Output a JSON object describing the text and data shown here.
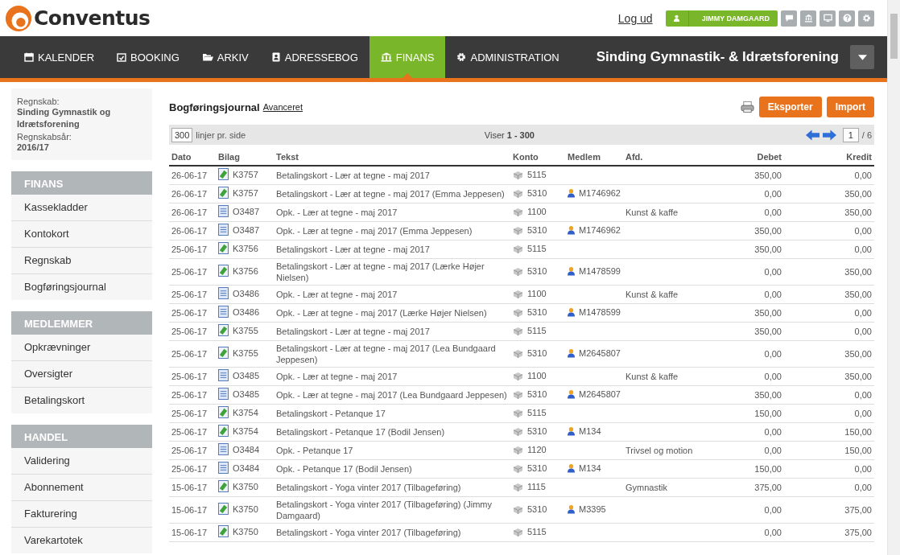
{
  "header": {
    "logo": "Conventus",
    "logout": "Log ud",
    "user": "JIMMY DAMGAARD"
  },
  "nav": {
    "items": [
      {
        "label": "KALENDER",
        "selected": false
      },
      {
        "label": "BOOKING",
        "selected": false
      },
      {
        "label": "ARKIV",
        "selected": false
      },
      {
        "label": "ADRESSEBOG",
        "selected": false
      },
      {
        "label": "FINANS",
        "selected": true
      },
      {
        "label": "ADMINISTRATION",
        "selected": false
      }
    ],
    "organization": "Sinding Gymnastik- & Idrætsforening"
  },
  "sidebar": {
    "info": [
      {
        "label": "Regnskab:",
        "value": "Sinding Gymnastik og Idrætsforening"
      },
      {
        "label": "Regnskabsår:",
        "value": "2016/17"
      }
    ],
    "sections": [
      {
        "title": "FINANS",
        "items": [
          {
            "label": "Kassekladder"
          },
          {
            "label": "Kontokort"
          },
          {
            "label": "Regnskab"
          },
          {
            "label": "Bogføringsjournal"
          }
        ]
      },
      {
        "title": "MEDLEMMER",
        "items": [
          {
            "label": "Opkrævninger"
          },
          {
            "label": "Oversigter"
          },
          {
            "label": "Betalingskort"
          }
        ]
      },
      {
        "title": "HANDEL",
        "items": [
          {
            "label": "Validering"
          },
          {
            "label": "Abonnement"
          },
          {
            "label": "Fakturering"
          },
          {
            "label": "Varekartotek"
          }
        ]
      }
    ]
  },
  "main": {
    "title": "Bogføringsjournal",
    "advanced_link": "Avanceret",
    "buttons": [
      "Eksporter",
      "Import"
    ],
    "pager": {
      "per_page": "300",
      "per_page_label": "linjer pr. side",
      "showing_prefix": "Viser",
      "showing_range": "1 - 300",
      "page": "1",
      "total": "/ 6"
    },
    "table": {
      "columns": [
        "Dato",
        "Bilag",
        "Tekst",
        "Konto",
        "Medlem",
        "Afd.",
        "Debet",
        "Kredit"
      ],
      "rows": [
        {
          "dato": "26-06-17",
          "kind": "card",
          "bilag": "K3757",
          "tekst": "Betalingskort - Lær at tegne - maj 2017",
          "konto": "5115",
          "debet": "350,00",
          "kredit": "0,00"
        },
        {
          "dato": "26-06-17",
          "kind": "card",
          "bilag": "K3757",
          "tekst": "Betalingskort - Lær at tegne - maj 2017 (Emma Jeppesen)",
          "konto": "5310",
          "medlem": "M1746962",
          "debet": "0,00",
          "kredit": "350,00"
        },
        {
          "dato": "26-06-17",
          "kind": "invoice",
          "bilag": "O3487",
          "tekst": "Opk. - Lær at tegne - maj 2017",
          "konto": "1100",
          "afd": "Kunst & kaffe",
          "debet": "0,00",
          "kredit": "350,00"
        },
        {
          "dato": "26-06-17",
          "kind": "invoice",
          "bilag": "O3487",
          "tekst": "Opk. - Lær at tegne - maj 2017 (Emma Jeppesen)",
          "konto": "5310",
          "medlem": "M1746962",
          "debet": "350,00",
          "kredit": "0,00"
        },
        {
          "dato": "25-06-17",
          "kind": "card",
          "bilag": "K3756",
          "tekst": "Betalingskort - Lær at tegne - maj 2017",
          "konto": "5115",
          "debet": "350,00",
          "kredit": "0,00"
        },
        {
          "dato": "25-06-17",
          "kind": "card",
          "bilag": "K3756",
          "tekst": "Betalingskort - Lær at tegne - maj 2017 (Lærke Højer Nielsen)",
          "konto": "5310",
          "medlem": "M1478599",
          "debet": "0,00",
          "kredit": "350,00"
        },
        {
          "dato": "25-06-17",
          "kind": "invoice",
          "bilag": "O3486",
          "tekst": "Opk. - Lær at tegne - maj 2017",
          "konto": "1100",
          "afd": "Kunst & kaffe",
          "debet": "0,00",
          "kredit": "350,00"
        },
        {
          "dato": "25-06-17",
          "kind": "invoice",
          "bilag": "O3486",
          "tekst": "Opk. - Lær at tegne - maj 2017 (Lærke Højer Nielsen)",
          "konto": "5310",
          "medlem": "M1478599",
          "debet": "350,00",
          "kredit": "0,00"
        },
        {
          "dato": "25-06-17",
          "kind": "card",
          "bilag": "K3755",
          "tekst": "Betalingskort - Lær at tegne - maj 2017",
          "konto": "5115",
          "debet": "350,00",
          "kredit": "0,00"
        },
        {
          "dato": "25-06-17",
          "kind": "card",
          "bilag": "K3755",
          "tekst": "Betalingskort - Lær at tegne - maj 2017 (Lea Bundgaard Jeppesen)",
          "konto": "5310",
          "medlem": "M2645807",
          "debet": "0,00",
          "kredit": "350,00"
        },
        {
          "dato": "25-06-17",
          "kind": "invoice",
          "bilag": "O3485",
          "tekst": "Opk. - Lær at tegne - maj 2017",
          "konto": "1100",
          "afd": "Kunst & kaffe",
          "debet": "0,00",
          "kredit": "350,00"
        },
        {
          "dato": "25-06-17",
          "kind": "invoice",
          "bilag": "O3485",
          "tekst": "Opk. - Lær at tegne - maj 2017 (Lea Bundgaard Jeppesen)",
          "konto": "5310",
          "medlem": "M2645807",
          "debet": "350,00",
          "kredit": "0,00"
        },
        {
          "dato": "25-06-17",
          "kind": "card",
          "bilag": "K3754",
          "tekst": "Betalingskort - Petanque 17",
          "konto": "5115",
          "debet": "150,00",
          "kredit": "0,00"
        },
        {
          "dato": "25-06-17",
          "kind": "card",
          "bilag": "K3754",
          "tekst": "Betalingskort - Petanque 17 (Bodil Jensen)",
          "konto": "5310",
          "medlem": "M134",
          "debet": "0,00",
          "kredit": "150,00"
        },
        {
          "dato": "25-06-17",
          "kind": "invoice",
          "bilag": "O3484",
          "tekst": "Opk. - Petanque 17",
          "konto": "1120",
          "afd": "Trivsel og motion",
          "debet": "0,00",
          "kredit": "150,00"
        },
        {
          "dato": "25-06-17",
          "kind": "invoice",
          "bilag": "O3484",
          "tekst": "Opk. - Petanque 17 (Bodil Jensen)",
          "konto": "5310",
          "medlem": "M134",
          "debet": "150,00",
          "kredit": "0,00"
        },
        {
          "dato": "15-06-17",
          "kind": "card",
          "bilag": "K3750",
          "tekst": "Betalingskort - Yoga vinter 2017 (Tilbageføring)",
          "konto": "1115",
          "afd": "Gymnastik",
          "debet": "375,00",
          "kredit": "0,00"
        },
        {
          "dato": "15-06-17",
          "kind": "card",
          "bilag": "K3750",
          "tekst": "Betalingskort - Yoga vinter 2017 (Tilbageføring) (Jimmy Damgaard)",
          "konto": "5310",
          "medlem": "M3395",
          "debet": "0,00",
          "kredit": "375,00"
        },
        {
          "dato": "15-06-17",
          "kind": "card",
          "bilag": "K3750",
          "tekst": "Betalingskort - Yoga vinter 2017 (Tilbageføring)",
          "konto": "5115",
          "debet": "0,00",
          "kredit": "375,00"
        }
      ]
    }
  }
}
